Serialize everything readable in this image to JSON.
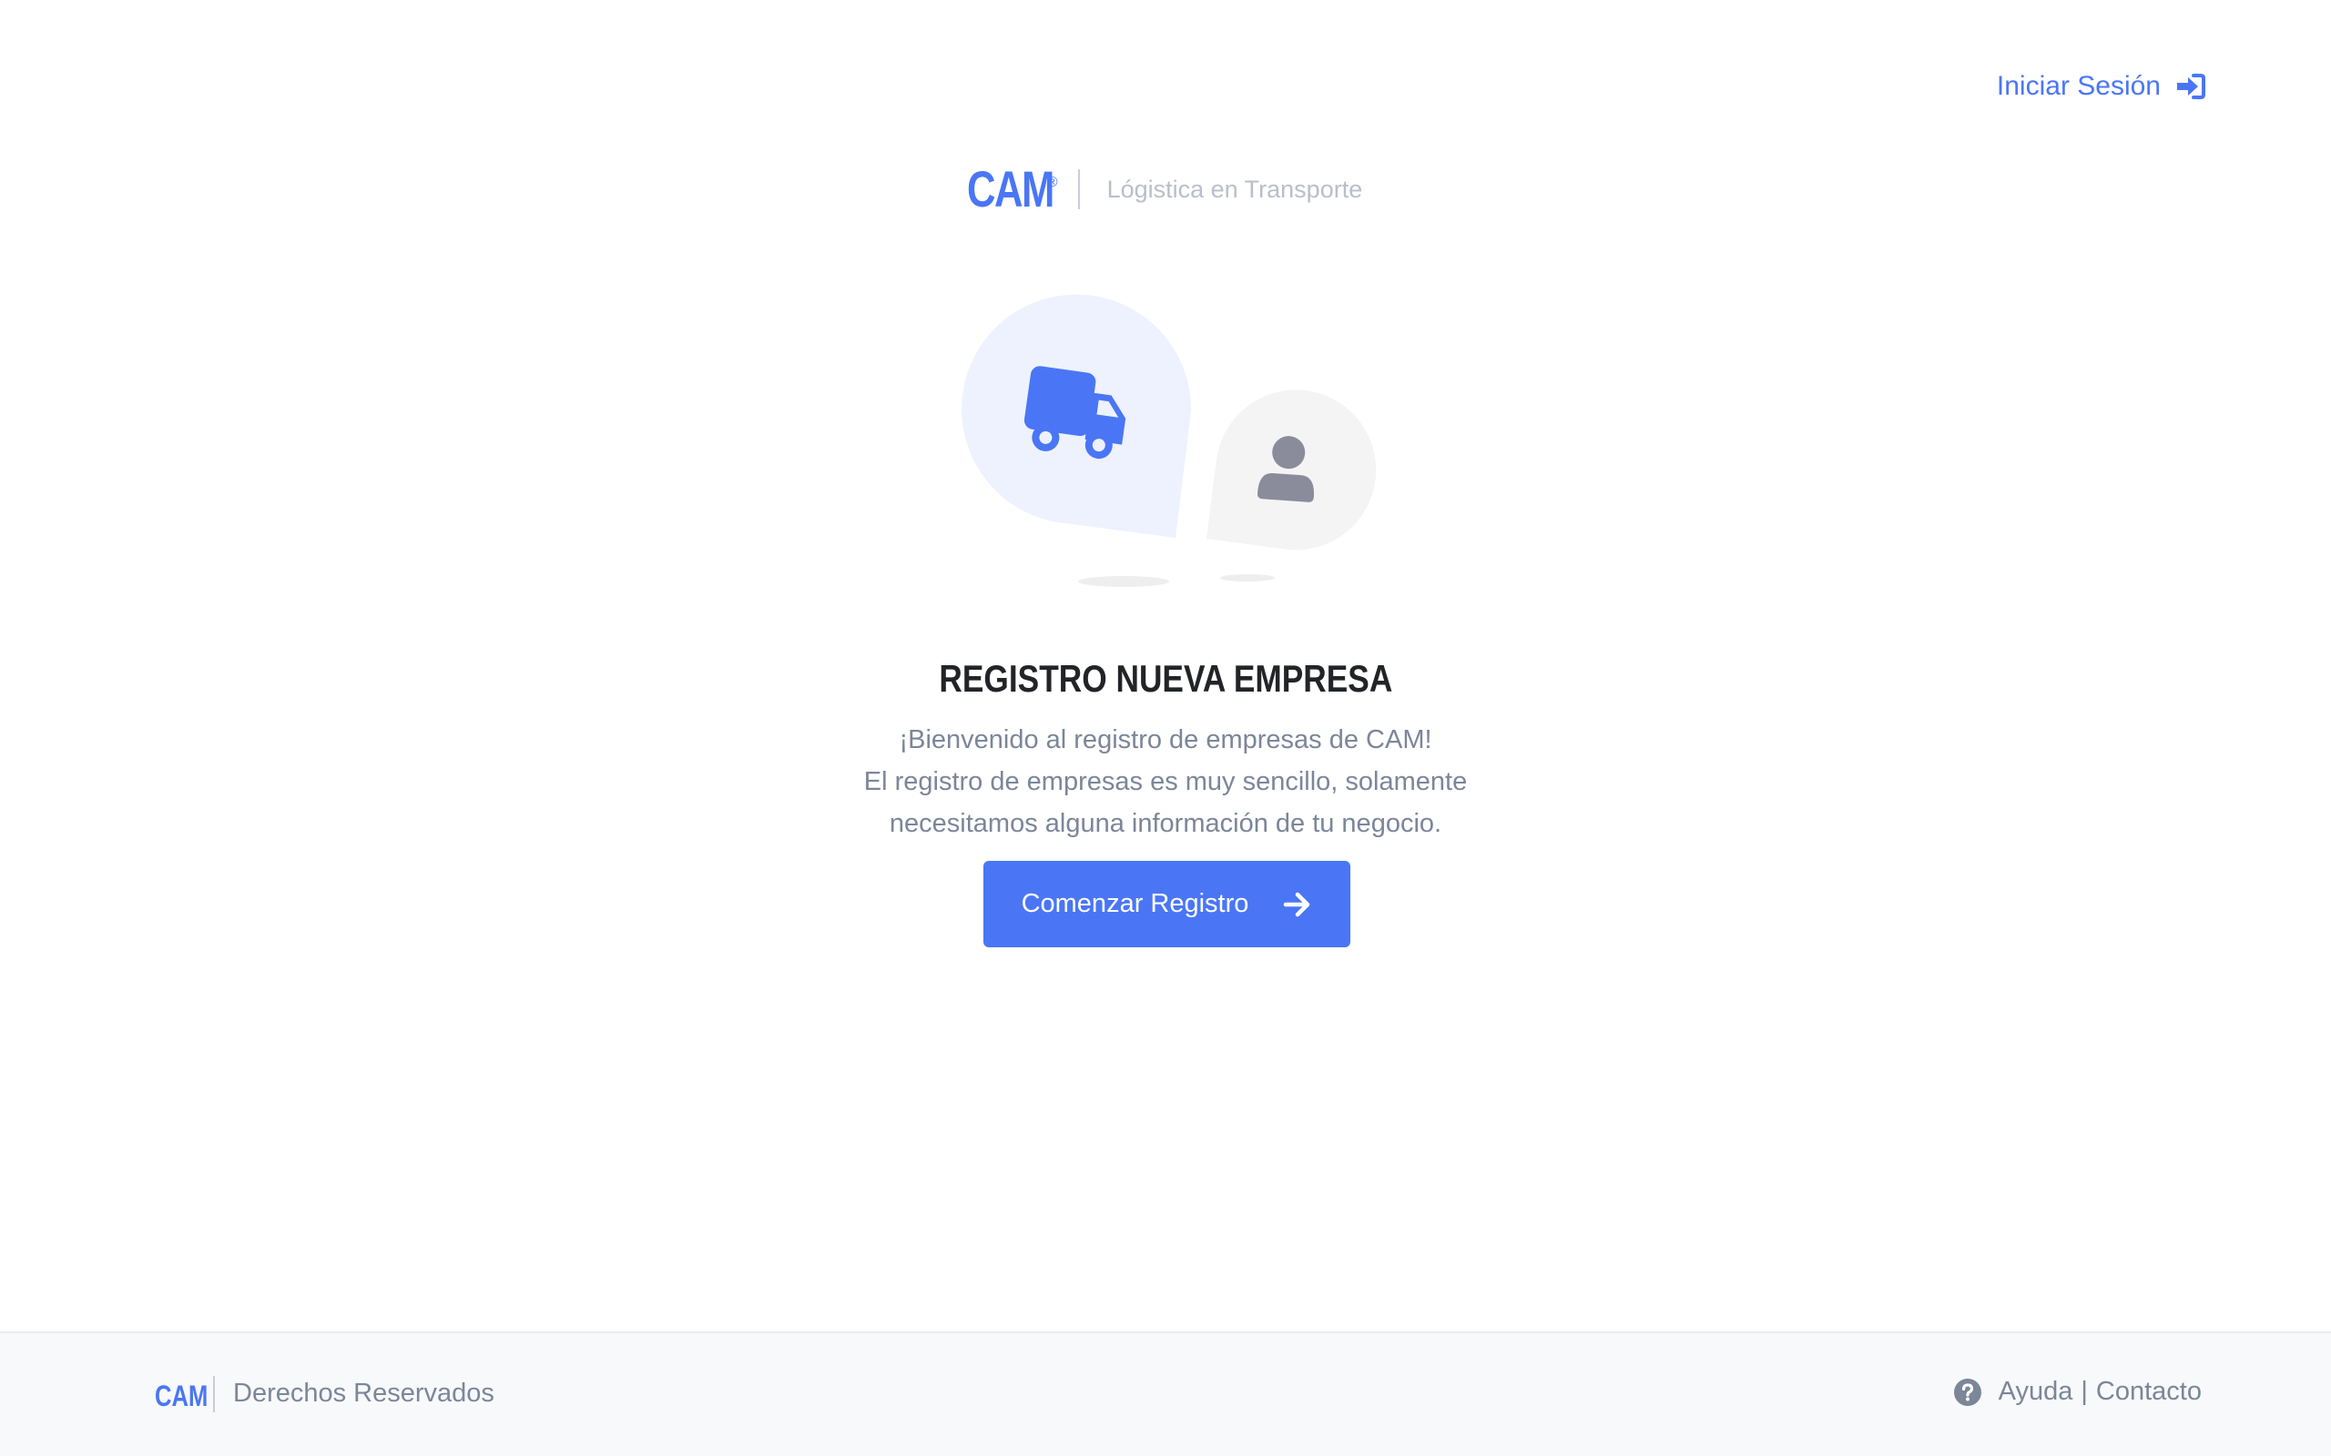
{
  "header": {
    "login_label": "Iniciar Sesión"
  },
  "brand": {
    "logo": "CAM",
    "registered": "®",
    "tagline": "Lógistica en Transporte"
  },
  "hero": {
    "title": "REGISTRO NUEVA EMPRESA",
    "lines": [
      "¡Bienvenido al registro de empresas de CAM!",
      "El registro de empresas es muy sencillo, solamente",
      "necesitamos alguna información de tu negocio."
    ],
    "cta_label": "Comenzar Registro"
  },
  "footer": {
    "logo": "CAM",
    "rights": "Derechos Reservados",
    "help_label": "Ayuda",
    "separator": "|",
    "contact_label": "Contacto"
  },
  "icons": {
    "login": "sign-in-icon",
    "truck": "truck-icon",
    "user": "user-icon",
    "arrow": "arrow-right-icon",
    "help": "question-circle-icon"
  },
  "colors": {
    "accent": "#4a76f5",
    "text_dark": "#222428",
    "text_muted": "#7b8699",
    "bubble_blue": "#edf2fe",
    "bubble_gray": "#f4f4f5",
    "user_gray": "#8a8c9c"
  }
}
